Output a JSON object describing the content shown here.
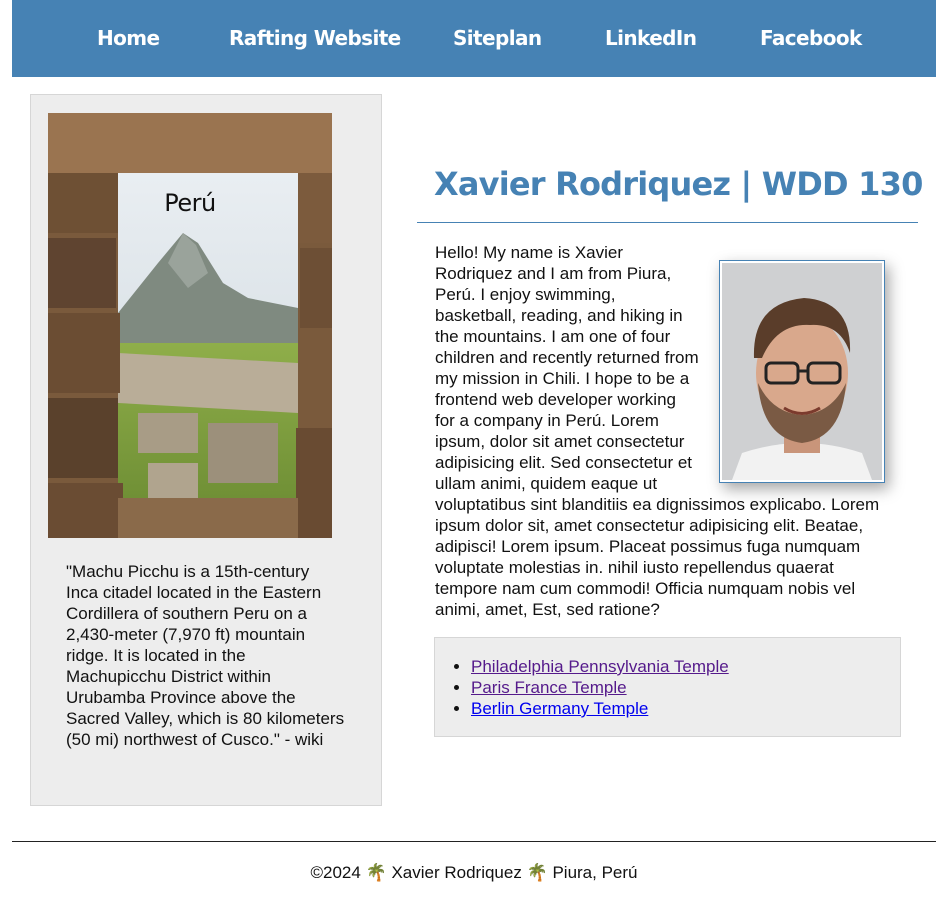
{
  "nav": {
    "items": [
      {
        "label": "Home"
      },
      {
        "label": "Rafting Website"
      },
      {
        "label": "Siteplan"
      },
      {
        "label": "LinkedIn"
      },
      {
        "label": "Facebook"
      }
    ]
  },
  "aside": {
    "image_caption": "Perú",
    "quote": "\"Machu Picchu is a 15th-century Inca citadel located in the Eastern Cordillera of southern Peru on a 2,430-meter (7,970 ft) mountain ridge. It is located in the Machupicchu District within Urubamba Province above the Sacred Valley, which is 80 kilometers (50 mi) northwest of Cusco.\" - wiki"
  },
  "main": {
    "title": "Xavier Rodriquez | WDD 130",
    "bio": "Hello! My name is Xavier Rodriquez and I am from Piura, Perú. I enjoy swimming, basketball, reading, and hiking in the mountains. I am one of four children and recently returned from my mission in Chili. I hope to be a frontend web developer working for a company in Perú. Lorem ipsum, dolor sit amet consectetur adipisicing elit. Sed consectetur et ullam animi, quidem eaque ut voluptatibus sint blanditiis ea dignissimos explicabo. Lorem ipsum dolor sit, amet consectetur adipisicing elit. Beatae, adipisci! Lorem ipsum. Placeat possimus fuga numquam voluptate molestias in. nihil iusto repellendus quaerat tempore nam cum commodi! Officia numquam nobis vel animi, amet, Est, sed ratione?",
    "temples": [
      {
        "label": "Philadelphia Pennsylvania Temple",
        "state": "visited"
      },
      {
        "label": "Paris France Temple",
        "state": "visited"
      },
      {
        "label": "Berlin Germany Temple",
        "state": "unvisited"
      }
    ]
  },
  "footer": {
    "text": "©2024 🌴 Xavier Rodriquez 🌴 Piura, Perú"
  },
  "colors": {
    "nav_bg": "#4682b4",
    "title": "#4682b4",
    "panel_bg": "#ededed",
    "link_visited": "#551a8b",
    "link_unvisited": "#0000ee"
  }
}
